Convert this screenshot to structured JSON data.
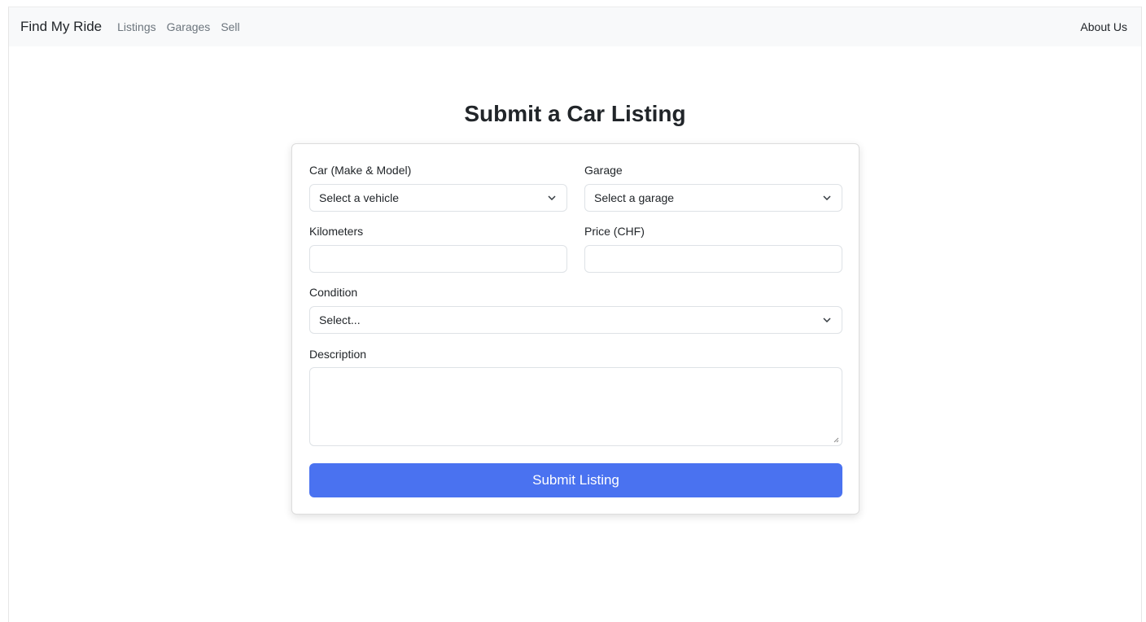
{
  "navbar": {
    "brand": "Find My Ride",
    "links": [
      "Listings",
      "Garages",
      "Sell"
    ],
    "right_link": "About Us"
  },
  "page": {
    "title": "Submit a Car Listing"
  },
  "form": {
    "car": {
      "label": "Car (Make & Model)",
      "value": "Select a vehicle"
    },
    "garage": {
      "label": "Garage",
      "value": "Select a garage"
    },
    "kilometers": {
      "label": "Kilometers",
      "value": ""
    },
    "price": {
      "label": "Price (CHF)",
      "value": ""
    },
    "condition": {
      "label": "Condition",
      "value": "Select..."
    },
    "description": {
      "label": "Description",
      "value": ""
    },
    "submit_label": "Submit Listing"
  },
  "icons": {
    "select_arrow": "chevron-down-icon",
    "resize": "resize-grip-icon"
  },
  "colors": {
    "accent": "#4a72f0",
    "navbar_bg": "#f8f9fa",
    "nav_link": "#6c757d"
  }
}
